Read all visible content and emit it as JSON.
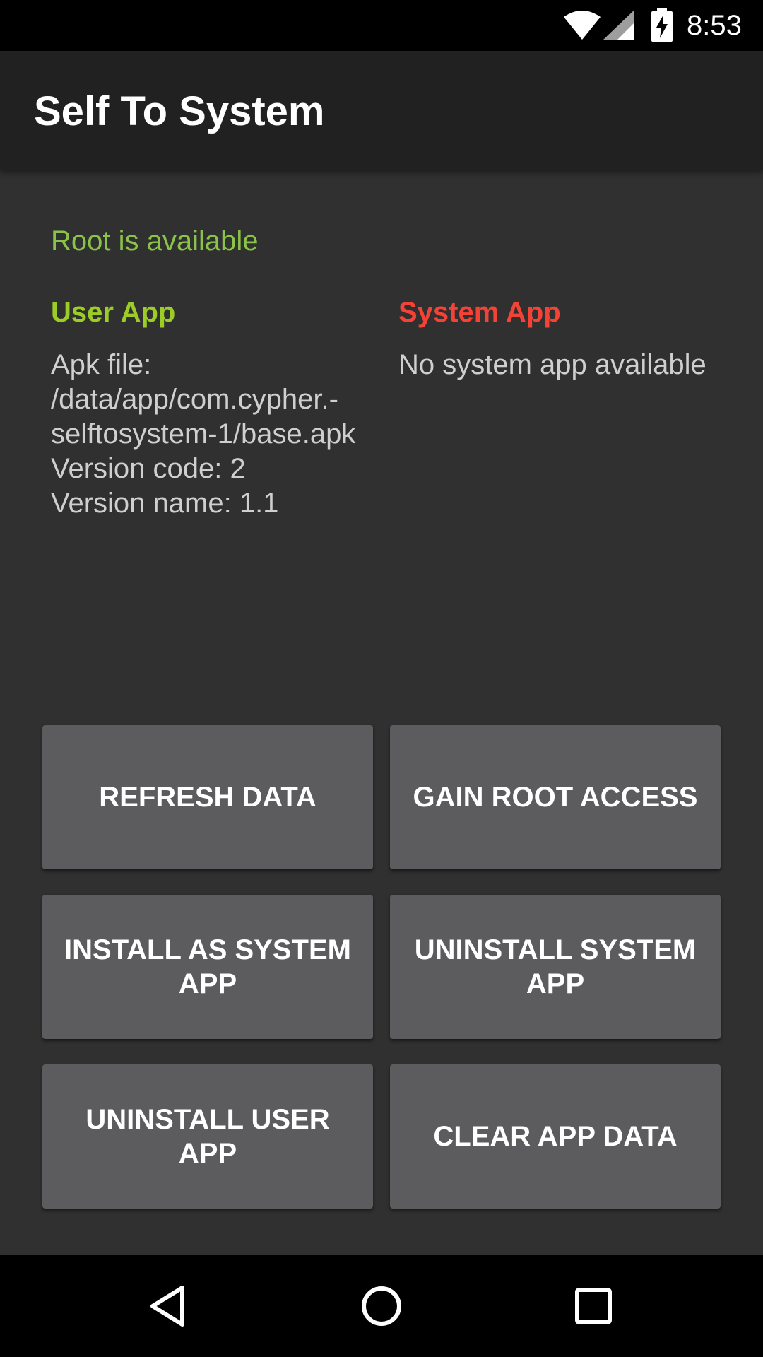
{
  "status_bar": {
    "time": "8:53",
    "icons": [
      "wifi-icon",
      "cell-signal-icon",
      "battery-charging-icon"
    ]
  },
  "app_bar": {
    "title": "Self To System"
  },
  "root_status": {
    "text": "Root is available",
    "color": "#8bc34a"
  },
  "user_app": {
    "heading": "User App",
    "heading_color": "#9ccc26",
    "details": "Apk file: /data/app/com.cypher.-selftosystem-1/base.apk\nVersion code: 2\nVersion name: 1.1"
  },
  "system_app": {
    "heading": "System App",
    "heading_color": "#f44336",
    "details": "No system app available"
  },
  "buttons": {
    "refresh": "REFRESH DATA",
    "gain_root": "GAIN ROOT ACCESS",
    "install_system": "INSTALL AS SYSTEM APP",
    "uninstall_system": "UNINSTALL SYSTEM APP",
    "uninstall_user": "UNINSTALL USER APP",
    "clear_data": "CLEAR APP DATA"
  },
  "nav_bar": {
    "icons": [
      "back-icon",
      "home-icon",
      "recents-icon"
    ]
  }
}
